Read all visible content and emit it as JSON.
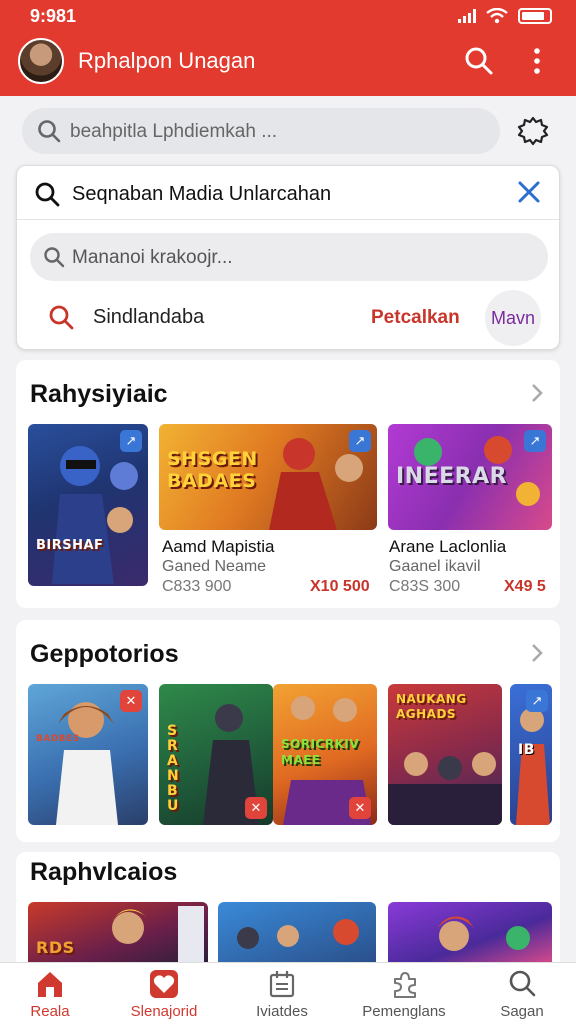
{
  "status_bar": {
    "time": "9:981"
  },
  "header": {
    "title": "Rphalpon Unagan"
  },
  "search": {
    "placeholder": "beahpitla Lphdiemkah ..."
  },
  "dropdown": {
    "query": "Seqnaban Madia  Unlarcahan",
    "suggestion": "Mananoi krakoojr...",
    "recent": "Sindlandaba",
    "action_link": "Petcalkan",
    "action_pill": "Mavn"
  },
  "sections": [
    {
      "title": "Rahysiyiaic",
      "cards": [
        {
          "art_text": "BIRSHAF"
        },
        {
          "art_text": "SHSGEN BADAES",
          "name": "Aamd Mapistia",
          "sub": "Ganed Neame",
          "price": "C833 900",
          "price_alt": "X10 500"
        },
        {
          "art_text": "INEERAR",
          "name": "Arane Laclonlia",
          "sub": "Gaanel ikavil",
          "price": "C83S 300",
          "price_alt": "X49  5"
        }
      ]
    },
    {
      "title": "Geppotorios",
      "cards": [
        {
          "art_text": "BADBES"
        },
        {
          "art_text": "SRANBU"
        },
        {
          "art_text": "SORICRKIV MAEE"
        },
        {
          "art_text": "NAUKANG AGHADS"
        },
        {
          "art_text": "IB"
        }
      ]
    },
    {
      "title": "Raphvlcaios",
      "cards": [
        {
          "art_text": "RDS"
        },
        {
          "art_text": ""
        },
        {
          "art_text": ""
        }
      ]
    }
  ],
  "bottom_nav": [
    {
      "label": "Reala",
      "icon": "home-icon",
      "active": true
    },
    {
      "label": "Slenajorid",
      "icon": "heart-icon",
      "active": true
    },
    {
      "label": "Iviatdes",
      "icon": "calendar-icon",
      "active": false
    },
    {
      "label": "Pemenglans",
      "icon": "puzzle-icon",
      "active": false
    },
    {
      "label": "Sagan",
      "icon": "search-icon",
      "active": false
    }
  ],
  "colors": {
    "accent": "#e23a2f",
    "link": "#c8352a",
    "pill_text": "#7b2c9e"
  }
}
